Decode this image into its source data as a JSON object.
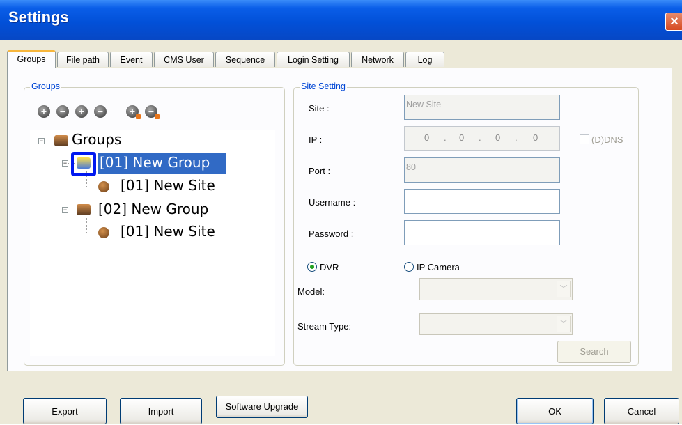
{
  "window": {
    "title": "Settings",
    "close_icon": "×"
  },
  "tabs": [
    "Groups",
    "File path",
    "Event",
    "CMS User",
    "Sequence",
    "Login Setting",
    "Network",
    "Log"
  ],
  "groups_panel": {
    "title": "Groups",
    "toolbar_icons": [
      "add-group-icon",
      "remove-group-icon",
      "add-site-icon",
      "remove-site-icon",
      "import-site-icon",
      "export-site-icon"
    ],
    "tree": {
      "root": "Groups",
      "group1": "[01] New Group",
      "group1_site": "[01] New Site",
      "group2": "[02] New Group",
      "group2_site": "[01] New Site"
    }
  },
  "site_setting": {
    "title": "Site Setting",
    "site_label": "Site :",
    "site_value": "New Site",
    "ip_label": "IP :",
    "ip_octets": [
      "0",
      "0",
      "0",
      "0"
    ],
    "ip_dot": ".",
    "ddns_label": "(D)DNS",
    "port_label": "Port :",
    "port_value": "80",
    "username_label": "Username :",
    "password_label": "Password :",
    "dvr_label": "DVR",
    "ipcam_label": "IP Camera",
    "model_label": "Model:",
    "stream_label": "Stream Type:",
    "combo_arrow": "﹀",
    "search_label": "Search"
  },
  "footer": {
    "export_label": "Export",
    "import_label": "Import",
    "upgrade_label": "Software Upgrade",
    "ok_label": "OK",
    "cancel_label": "Cancel"
  }
}
